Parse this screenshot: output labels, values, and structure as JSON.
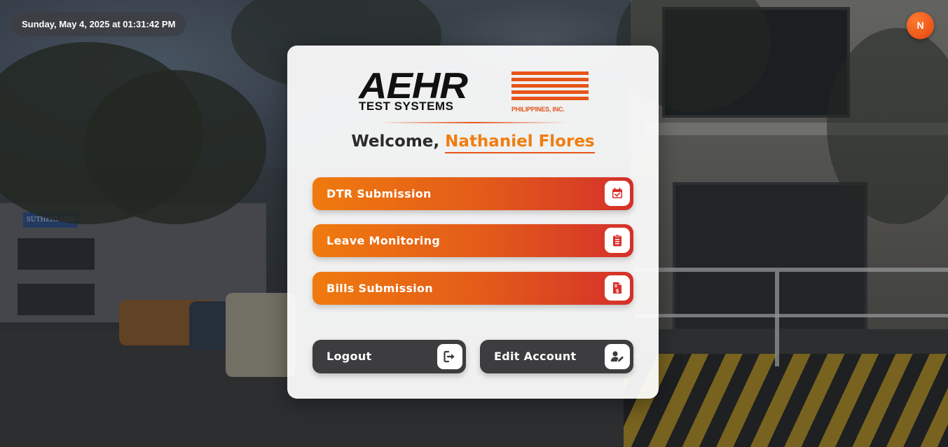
{
  "header": {
    "datetime": "Sunday, May 4, 2025 at 01:31:42 PM",
    "avatar_initial": "N"
  },
  "background": {
    "sign_text": "SUTHERLAND"
  },
  "card": {
    "logo": {
      "main": "AEHR",
      "sub": "TEST SYSTEMS",
      "country": "PHILIPPINES, INC."
    },
    "welcome_prefix": "Welcome,",
    "user_name": "Nathaniel Flores",
    "menu": [
      {
        "label": "DTR Submission",
        "icon": "calendar-check-icon"
      },
      {
        "label": "Leave Monitoring",
        "icon": "clipboard-list-icon"
      },
      {
        "label": "Bills Submission",
        "icon": "invoice-dollar-icon"
      }
    ],
    "actions": {
      "logout_label": "Logout",
      "logout_icon": "logout-icon",
      "edit_account_label": "Edit Account",
      "edit_account_icon": "user-edit-icon"
    }
  },
  "colors": {
    "accent_orange": "#f07a0e",
    "accent_red": "#d4302a",
    "dark_button": "#3d3d3f",
    "name_orange": "#f07d10"
  }
}
